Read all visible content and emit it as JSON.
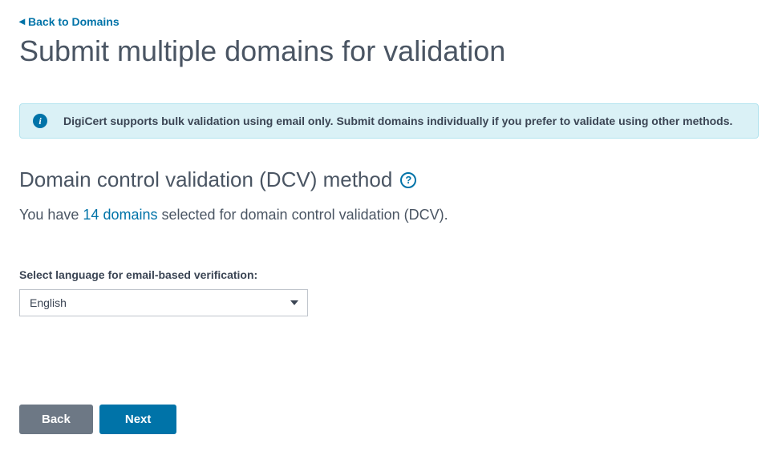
{
  "nav": {
    "back_label": "Back to Domains"
  },
  "header": {
    "title": "Submit multiple domains for validation"
  },
  "banner": {
    "text": "DigiCert supports bulk validation using email only. Submit domains individually if you prefer to validate using other methods.",
    "icon_glyph": "i"
  },
  "section": {
    "title": "Domain control validation (DCV) method",
    "help_glyph": "?"
  },
  "selection": {
    "prefix": "You have ",
    "link_text": "14 domains",
    "suffix": " selected for domain control validation (DCV)."
  },
  "language_field": {
    "label": "Select language for email-based verification:",
    "selected": "English"
  },
  "buttons": {
    "back": "Back",
    "next": "Next"
  }
}
